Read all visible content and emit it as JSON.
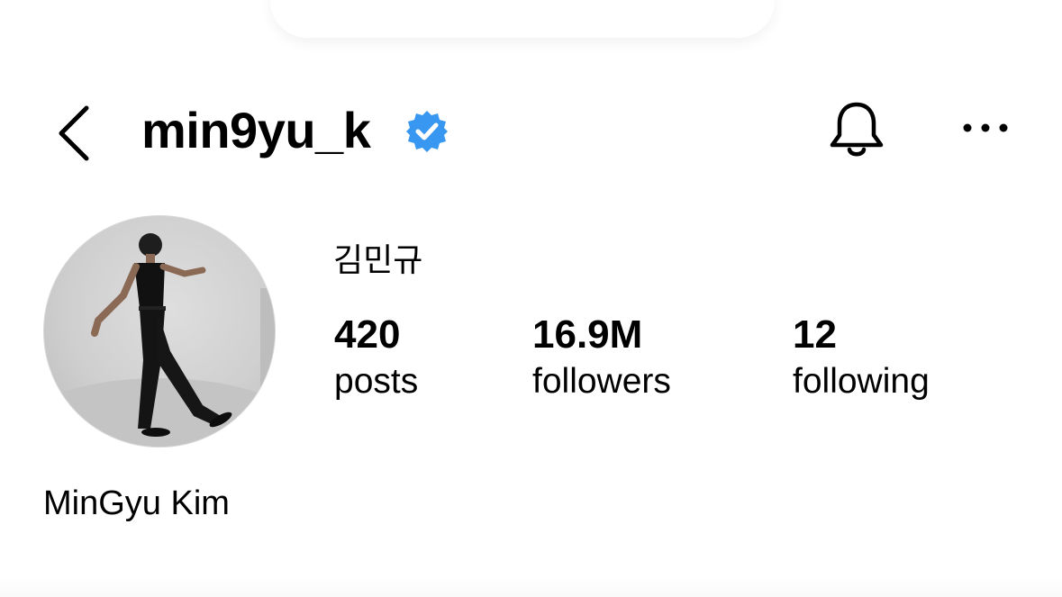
{
  "header": {
    "username": "min9yu_k",
    "back_icon": "chevron-left-icon",
    "verified_icon": "verified-badge-icon",
    "notifications_icon": "bell-icon",
    "more_icon": "ellipsis-icon",
    "verified_color": "#3897f0"
  },
  "profile": {
    "korean_name": "김민규",
    "display_name": "MinGyu Kim",
    "avatar": "profile-photo"
  },
  "stats": {
    "posts": {
      "count": "420",
      "label": "posts"
    },
    "followers": {
      "count": "16.9M",
      "label": "followers"
    },
    "following": {
      "count": "12",
      "label": "following"
    }
  }
}
